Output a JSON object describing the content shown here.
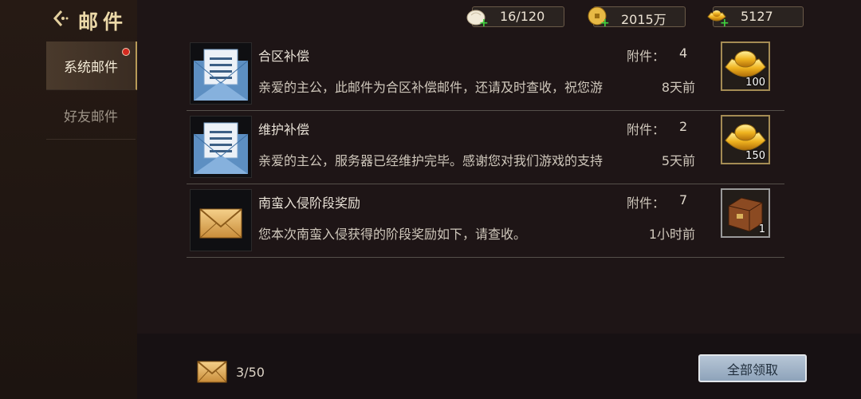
{
  "header": {
    "title": "邮件"
  },
  "sidebar": {
    "tabs": [
      {
        "label": "系统邮件",
        "active": true,
        "has_notification": true
      },
      {
        "label": "好友邮件",
        "active": false
      }
    ]
  },
  "currencies": [
    {
      "icon": "steamed-bun-icon",
      "value": "16/120"
    },
    {
      "icon": "copper-coin-icon",
      "value": "2015万"
    },
    {
      "icon": "gold-ingot-icon",
      "value": "5127"
    }
  ],
  "mails": [
    {
      "icon": "open-letter-icon",
      "subject": "合区补偿",
      "body": "亲爱的主公，此邮件为合区补偿邮件，还请及时查收，祝您游",
      "attachment_label": "附件：",
      "attachment_count": "4",
      "time": "8天前",
      "reward": {
        "icon": "gold-ingot-icon",
        "quantity": "100"
      }
    },
    {
      "icon": "open-letter-icon",
      "subject": "维护补偿",
      "body": "亲爱的主公，服务器已经维护完毕。感谢您对我们游戏的支持",
      "attachment_label": "附件：",
      "attachment_count": "2",
      "time": "5天前",
      "reward": {
        "icon": "gold-ingot-icon",
        "quantity": "150"
      }
    },
    {
      "icon": "sealed-envelope-icon",
      "subject": "南蛮入侵阶段奖励",
      "body": "您本次南蛮入侵获得的阶段奖励如下，请查收。",
      "attachment_label": "附件：",
      "attachment_count": "7",
      "time": "1小时前",
      "reward": {
        "icon": "treasure-chest-icon",
        "quantity": "1"
      }
    }
  ],
  "footer": {
    "mail_count": "3/50",
    "claim_all_label": "全部领取"
  },
  "colors": {
    "gold": "#e3cf9e",
    "claim_button": "#b7c6d6",
    "notification": "#d32a20"
  }
}
